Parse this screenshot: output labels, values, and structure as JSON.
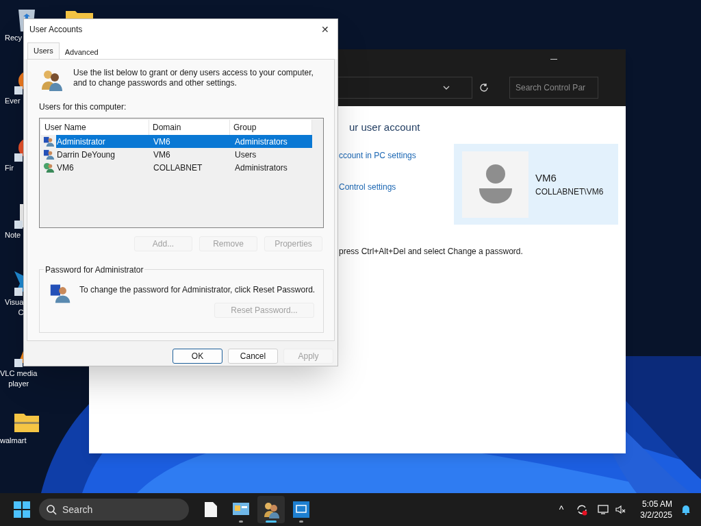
{
  "desktop_icons": [
    {
      "kind": "recycle",
      "lines": [
        "Recy"
      ]
    },
    {
      "kind": "edge",
      "lines": [
        "Ever"
      ]
    },
    {
      "kind": "firefox",
      "lines": [
        "Fir"
      ]
    },
    {
      "kind": "notepad",
      "lines": [
        "Note"
      ]
    },
    {
      "kind": "vscode",
      "lines": [
        "Visua",
        "C"
      ]
    },
    {
      "kind": "vlc",
      "lines": [
        "VLC media",
        "player"
      ]
    },
    {
      "kind": "zip",
      "lines": [
        "walmart"
      ]
    }
  ],
  "control_panel": {
    "search_placeholder": "Search Control Par",
    "heading": "ur user account",
    "links": [
      "ccount in PC settings",
      "Control settings"
    ],
    "note": "press Ctrl+Alt+Del and select Change a password.",
    "user_card": {
      "name": "VM6",
      "account": "COLLABNET\\VM6"
    }
  },
  "dialog": {
    "title": "User Accounts",
    "close": "✕",
    "tabs": [
      {
        "label": "Users",
        "selected": true
      },
      {
        "label": "Advanced",
        "selected": false
      }
    ],
    "intro": "Use the list below to grant or deny users access to your computer, and to change passwords and other settings.",
    "list_label": "Users for this computer:",
    "columns": [
      "User Name",
      "Domain",
      "Group"
    ],
    "rows": [
      {
        "cells": [
          "Administrator",
          "VM6",
          "Administrators"
        ],
        "selected": true,
        "kind": "local"
      },
      {
        "cells": [
          "Darrin DeYoung",
          "VM6",
          "Users"
        ],
        "selected": false,
        "kind": "local"
      },
      {
        "cells": [
          "VM6",
          "COLLABNET",
          "Administrators"
        ],
        "selected": false,
        "kind": "domain"
      }
    ],
    "list_buttons": [
      {
        "label": "Add...",
        "disabled": true
      },
      {
        "label": "Remove",
        "disabled": true
      },
      {
        "label": "Properties",
        "disabled": true
      }
    ],
    "password_group": {
      "title": "Password for Administrator",
      "text": "To change the password for Administrator, click Reset Password.",
      "button": {
        "label": "Reset Password...",
        "disabled": true
      }
    },
    "footer_buttons": [
      {
        "label": "OK",
        "disabled": false,
        "focused": true
      },
      {
        "label": "Cancel",
        "disabled": false,
        "focused": false
      },
      {
        "label": "Apply",
        "disabled": true,
        "focused": false
      }
    ]
  },
  "taskbar": {
    "search_placeholder": "Search",
    "apps": [
      {
        "kind": "file",
        "active": false,
        "running": false
      },
      {
        "kind": "control-panel",
        "active": false,
        "running": true
      },
      {
        "kind": "users",
        "active": true,
        "running": true
      },
      {
        "kind": "monitor",
        "active": false,
        "running": true
      }
    ],
    "tray_chevron": "^",
    "time": "5:05 AM",
    "date": "3/2/2025"
  }
}
